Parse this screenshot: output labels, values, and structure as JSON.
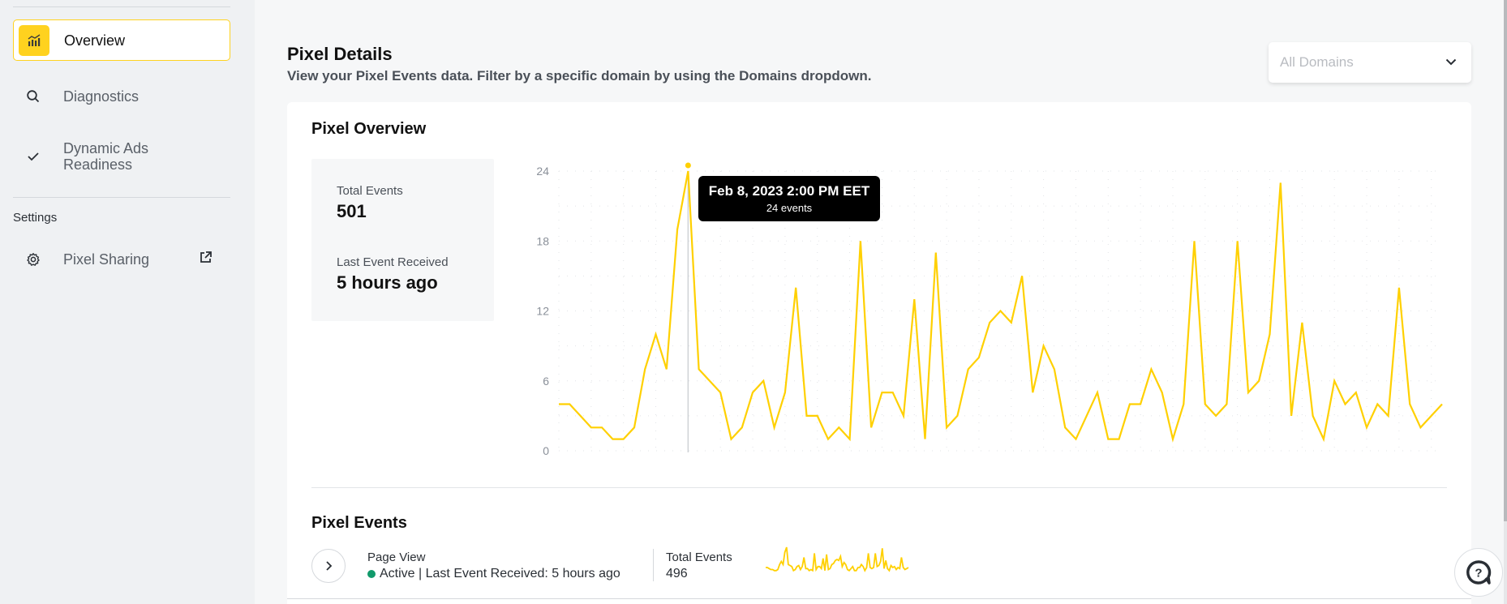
{
  "sidebar": {
    "items": [
      {
        "label": "Overview",
        "icon": "chart-icon",
        "active": true
      },
      {
        "label": "Diagnostics",
        "icon": "search-icon"
      },
      {
        "label": "Dynamic Ads Readiness",
        "icon": "check-icon"
      }
    ],
    "settings_heading": "Settings",
    "settings_items": [
      {
        "label": "Pixel Sharing",
        "icon": "gear-icon",
        "trailing_icon": "external-link-icon"
      }
    ]
  },
  "header": {
    "title": "Pixel Details",
    "subtitle": "View your Pixel Events data. Filter by a specific domain by using the Domains dropdown.",
    "domains_dropdown": {
      "placeholder": "All Domains"
    }
  },
  "overview": {
    "title": "Pixel Overview",
    "stats": {
      "total_events_label": "Total Events",
      "total_events_value": "501",
      "last_event_label": "Last Event Received",
      "last_event_value": "5 hours ago"
    },
    "tooltip": {
      "title": "Feb 8, 2023 2:00 PM EET",
      "value": "24 events",
      "index": 12
    }
  },
  "events": {
    "title": "Pixel Events",
    "rows": [
      {
        "name": "Page View",
        "status": "Active",
        "status_color": "#119a6b",
        "last_event": "Last Event Received: 5 hours ago",
        "total_label": "Total Events",
        "total_value": "496"
      }
    ]
  },
  "colors": {
    "accent": "#ffd21f",
    "line": "#ffd000",
    "tooltip_bg": "#000000"
  },
  "chart_data": {
    "type": "line",
    "title": "Pixel Overview",
    "xlabel": "",
    "ylabel": "",
    "ylim": [
      0,
      24
    ],
    "yticks": [
      0,
      6,
      12,
      18,
      24
    ],
    "grid": true,
    "series": [
      {
        "name": "Events",
        "values": [
          4,
          4,
          3,
          2,
          2,
          1,
          1,
          2,
          7,
          10,
          7,
          19,
          24,
          7,
          6,
          5,
          1,
          2,
          5,
          6,
          2,
          5,
          14,
          3,
          3,
          1,
          2,
          1,
          18,
          2,
          5,
          5,
          3,
          13,
          1,
          17,
          2,
          3,
          7,
          8,
          11,
          12,
          11,
          15,
          5,
          9,
          7,
          2,
          1,
          3,
          5,
          1,
          1,
          4,
          4,
          7,
          5,
          1,
          4,
          18,
          4,
          3,
          4,
          18,
          5,
          6,
          10,
          23,
          3,
          11,
          3,
          1,
          6,
          4,
          5,
          2,
          4,
          3,
          14,
          4,
          2,
          3,
          4
        ]
      }
    ],
    "highlight": {
      "index": 12,
      "label": "Feb 8, 2023 2:00 PM EET",
      "value": 24
    }
  },
  "sparkline_data": {
    "type": "line",
    "series": [
      {
        "name": "Page View",
        "values": [
          4,
          4,
          3,
          2,
          2,
          1,
          1,
          2,
          7,
          10,
          7,
          19,
          24,
          7,
          6,
          5,
          1,
          2,
          5,
          6,
          2,
          5,
          14,
          3,
          3,
          1,
          2,
          1,
          18,
          2,
          5,
          5,
          3,
          13,
          1,
          17,
          2,
          3,
          7,
          8,
          11,
          12,
          11,
          15,
          5,
          9,
          7,
          2,
          1,
          3,
          5,
          1,
          1,
          4,
          4,
          7,
          5,
          1,
          4,
          18,
          4,
          3,
          4,
          18,
          5,
          6,
          10,
          23,
          3,
          11,
          3,
          1,
          6,
          4,
          5,
          2,
          4,
          3,
          14,
          4,
          2,
          3,
          4
        ]
      }
    ]
  }
}
